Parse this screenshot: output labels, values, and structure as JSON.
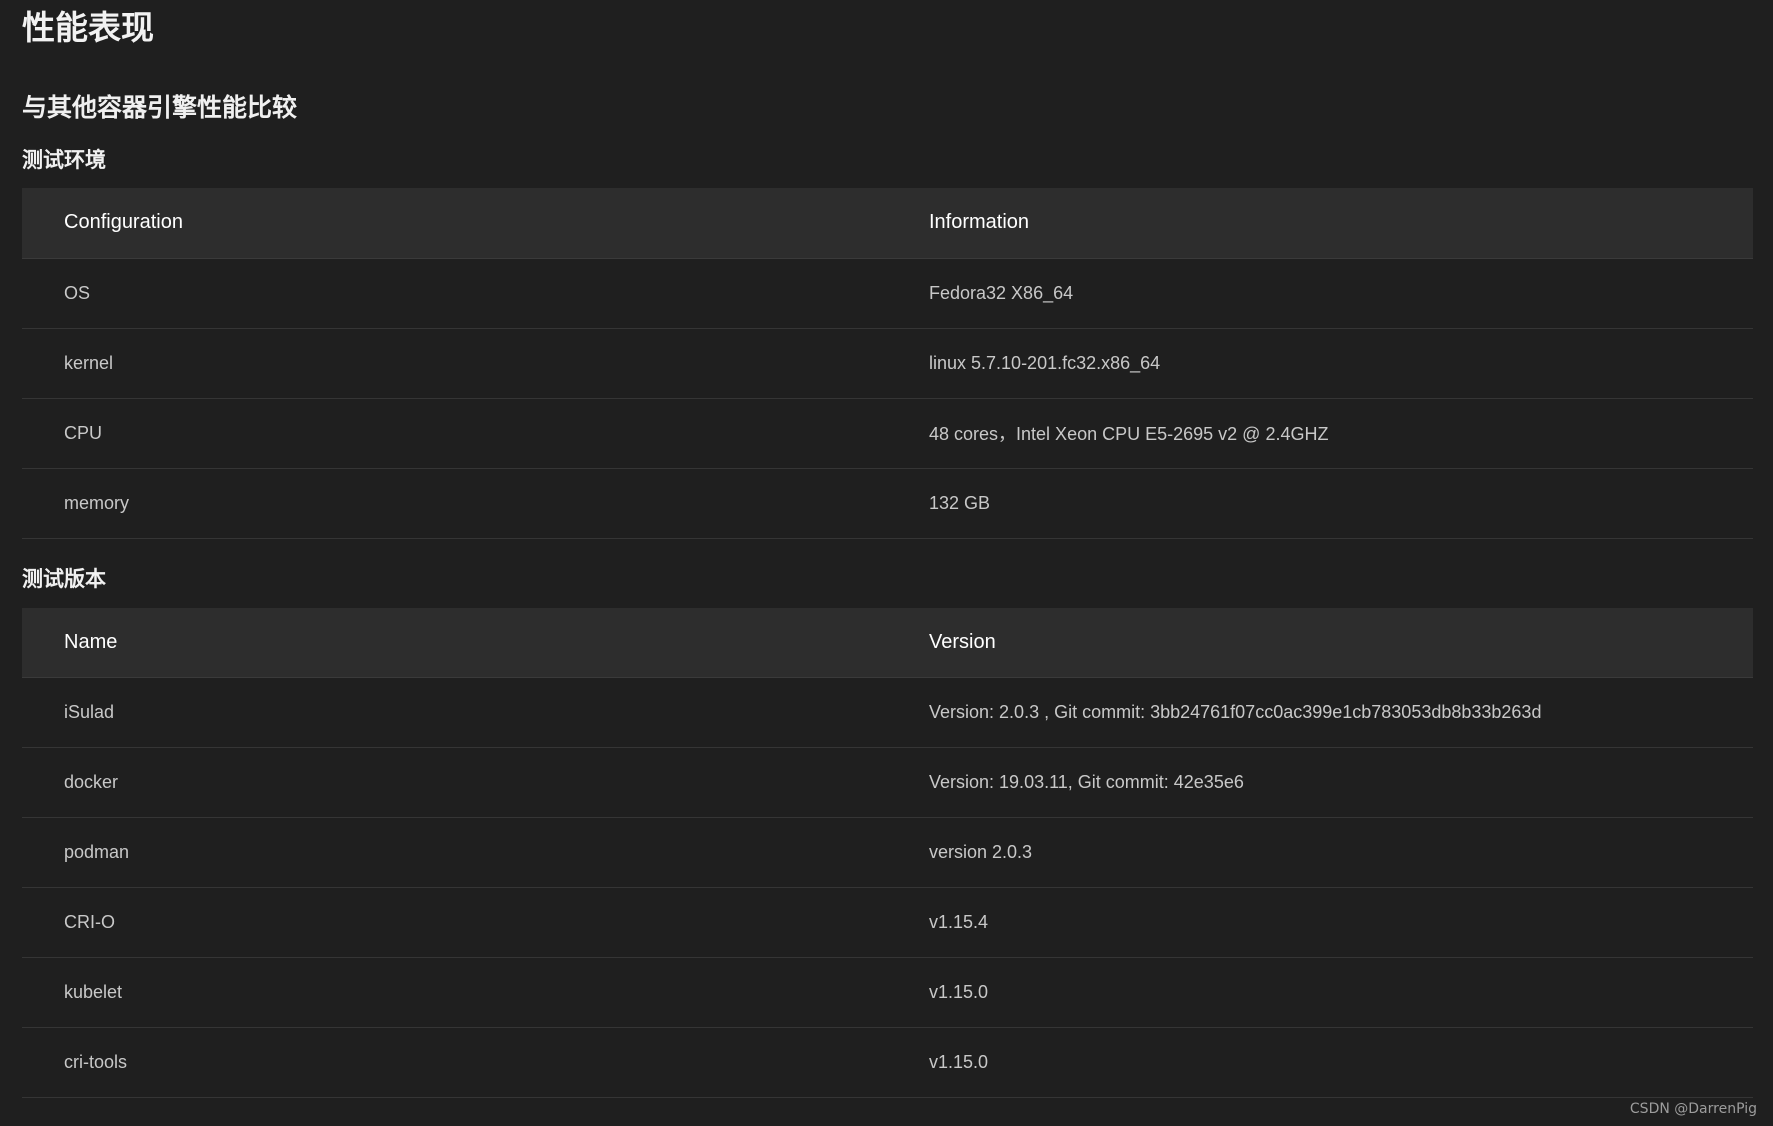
{
  "page": {
    "title": "性能表现",
    "section_title": "与其他容器引擎性能比较"
  },
  "env": {
    "title": "测试环境",
    "headers": [
      "Configuration",
      "Information"
    ],
    "rows": [
      [
        "OS",
        "Fedora32 X86_64"
      ],
      [
        "kernel",
        "linux 5.7.10-201.fc32.x86_64"
      ],
      [
        "CPU",
        "48 cores，Intel Xeon CPU E5-2695 v2 @ 2.4GHZ"
      ],
      [
        "memory",
        "132 GB"
      ]
    ]
  },
  "versions": {
    "title": "测试版本",
    "headers": [
      "Name",
      "Version"
    ],
    "rows": [
      [
        "iSulad",
        "Version: 2.0.3 , Git commit: 3bb24761f07cc0ac399e1cb783053db8b33b263d"
      ],
      [
        "docker",
        "Version: 19.03.11, Git commit: 42e35e6"
      ],
      [
        "podman",
        "version 2.0.3"
      ],
      [
        "CRI-O",
        "v1.15.4"
      ],
      [
        "kubelet",
        "v1.15.0"
      ],
      [
        "cri-tools",
        "v1.15.0"
      ]
    ]
  },
  "watermark": "CSDN @DarrenPig"
}
